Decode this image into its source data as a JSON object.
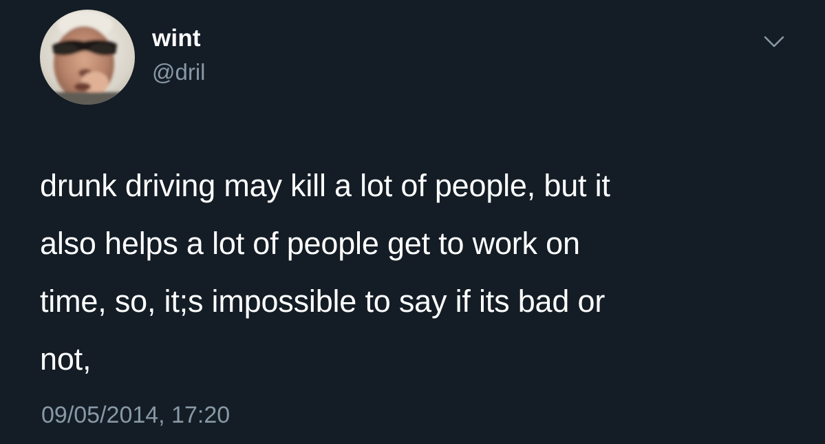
{
  "tweet": {
    "author": {
      "display_name": "wint",
      "handle": "@dril"
    },
    "text": "drunk driving may kill a lot of people, but it\nalso helps a lot of people get to work on\ntime, so, it;s impossible to say if its bad or\nnot,",
    "timestamp": "09/05/2014, 17:20",
    "icons": {
      "menu": "chevron-down-icon",
      "avatar": "profile-photo"
    }
  },
  "colors": {
    "background": "#141d26",
    "primary_text": "#ffffff",
    "secondary_text": "#8899a6"
  }
}
